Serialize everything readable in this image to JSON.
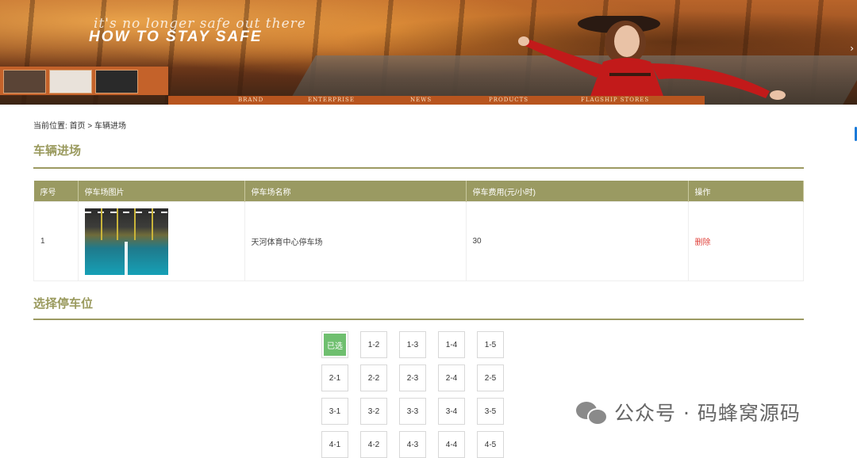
{
  "banner": {
    "tagline": "it's no longer safe out there",
    "headline": "HOW TO STAY SAFE",
    "nav": [
      "BRAND",
      "ENTERPRISE",
      "NEWS",
      "PRODUCTS",
      "FLAGSHIP STORES"
    ],
    "next_icon": "chevron-right-icon"
  },
  "breadcrumb": {
    "prefix": "当前位置:",
    "home": "首页",
    "separator": ">",
    "current": "车辆进场"
  },
  "section1": {
    "title": "车辆进场"
  },
  "table": {
    "headers": [
      "序号",
      "停车场图片",
      "停车场名称",
      "停车费用(元/小时)",
      "操作"
    ],
    "rows": [
      {
        "index": "1",
        "name": "天河体育中心停车场",
        "fee": "30",
        "action": "删除"
      }
    ]
  },
  "section2": {
    "title": "选择停车位"
  },
  "seats": {
    "rows": [
      [
        "已选",
        "1-2",
        "1-3",
        "1-4",
        "1-5"
      ],
      [
        "2-1",
        "2-2",
        "2-3",
        "2-4",
        "2-5"
      ],
      [
        "3-1",
        "3-2",
        "3-3",
        "3-4",
        "3-5"
      ],
      [
        "4-1",
        "4-2",
        "4-3",
        "4-4",
        "4-5"
      ]
    ],
    "selected_color": "#6fbf6f"
  },
  "watermark": {
    "text": "公众号 · 码蜂窝源码"
  },
  "colors": {
    "accent": "#9a9a62",
    "danger": "#e0413a"
  }
}
